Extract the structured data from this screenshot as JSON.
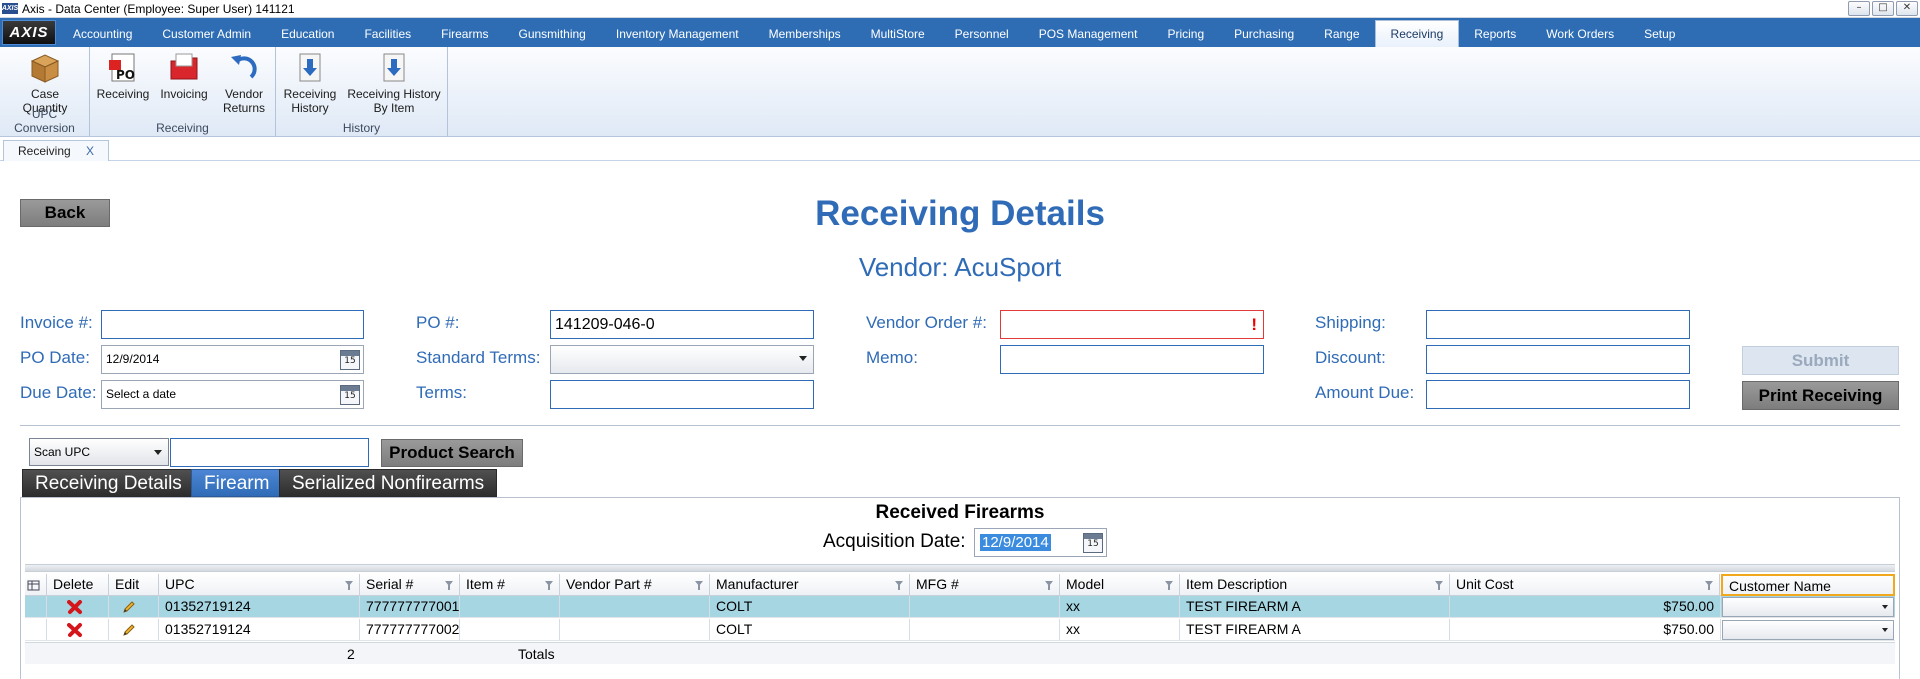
{
  "window": {
    "logo": "AXIS",
    "title": "Axis - Data Center  (Employee: Super User) 141121",
    "controls": [
      "–",
      "□",
      "✕"
    ]
  },
  "menubar": {
    "logo": "AXIS",
    "items": [
      "Accounting",
      "Customer Admin",
      "Education",
      "Facilities",
      "Firearms",
      "Gunsmithing",
      "Inventory Management",
      "Memberships",
      "MultiStore",
      "Personnel",
      "POS Management",
      "Pricing",
      "Purchasing",
      "Range",
      "Receiving",
      "Reports",
      "Work Orders",
      "Setup"
    ],
    "active": "Receiving"
  },
  "ribbon": {
    "groups": [
      {
        "label": "UPC Conversion",
        "buttons": [
          {
            "line1": "Case",
            "line2": "Quantity",
            "icon": "box-icon"
          }
        ]
      },
      {
        "label": "Receiving",
        "buttons": [
          {
            "line1": "Receiving",
            "line2": "",
            "icon": "po-icon"
          },
          {
            "line1": "Invoicing",
            "line2": "",
            "icon": "invoice-folder-icon"
          },
          {
            "line1": "Vendor",
            "line2": "Returns",
            "icon": "return-arrow-icon"
          }
        ]
      },
      {
        "label": "History",
        "buttons": [
          {
            "line1": "Receiving",
            "line2": "History",
            "icon": "history-download-icon"
          },
          {
            "line1": "Receiving History",
            "line2": "By Item",
            "icon": "history-by-item-icon"
          }
        ]
      }
    ]
  },
  "doc_tabs": [
    {
      "label": "Receiving",
      "close": "X"
    }
  ],
  "page": {
    "back": "Back",
    "title": "Receiving Details",
    "vendor": "Vendor: AcuSport"
  },
  "form": {
    "invoice_label": "Invoice #:",
    "invoice_value": "",
    "po_date_label": "PO Date:",
    "po_date_value": "12/9/2014",
    "due_date_label": "Due Date:",
    "due_date_value": "Select a date",
    "po_label": "PO #:",
    "po_value": "141209-046-0",
    "std_terms_label": "Standard Terms:",
    "std_terms_value": "",
    "terms_label": "Terms:",
    "terms_value": "",
    "vendor_order_label": "Vendor Order #:",
    "vendor_order_value": "",
    "vendor_order_error": "!",
    "memo_label": "Memo:",
    "memo_value": "",
    "shipping_label": "Shipping:",
    "shipping_value": "",
    "discount_label": "Discount:",
    "discount_value": "",
    "amount_due_label": "Amount Due:",
    "amount_due_value": "",
    "calendar_glyph": "15",
    "submit": "Submit",
    "print": "Print Receiving"
  },
  "scan": {
    "mode": "Scan UPC",
    "value": "",
    "search_button": "Product Search"
  },
  "tabs": [
    {
      "label": "Receiving Details",
      "active": false
    },
    {
      "label": "Firearm",
      "active": true
    },
    {
      "label": "Serialized Nonfirearms",
      "active": false
    }
  ],
  "grid": {
    "title": "Received Firearms",
    "acq_label": "Acquisition Date:",
    "acq_value": "12/9/2014",
    "columns": [
      "Delete",
      "Edit",
      "UPC",
      "Serial #",
      "Item #",
      "Vendor Part #",
      "Manufacturer",
      "MFG #",
      "Model",
      "Item Description",
      "Unit Cost",
      "Customer Name"
    ],
    "rows": [
      {
        "upc": "01352719124",
        "serial": "777777777001",
        "item": "",
        "vendor_part": "",
        "manufacturer": "COLT",
        "mfg": "",
        "model": "xx",
        "description": "TEST FIREARM A",
        "unit_cost": "$750.00",
        "customer": ""
      },
      {
        "upc": "01352719124",
        "serial": "777777777002",
        "item": "",
        "vendor_part": "",
        "manufacturer": "COLT",
        "mfg": "",
        "model": "xx",
        "description": "TEST FIREARM A",
        "unit_cost": "$750.00",
        "customer": ""
      }
    ],
    "totals_count": "2",
    "totals_label": "Totals"
  },
  "colors": {
    "accent": "#2f6bb6",
    "menubar": "#2e6db4",
    "selected_row": "#a7d6e3",
    "highlight_border": "#f1a81c",
    "error": "#e23a3a"
  }
}
